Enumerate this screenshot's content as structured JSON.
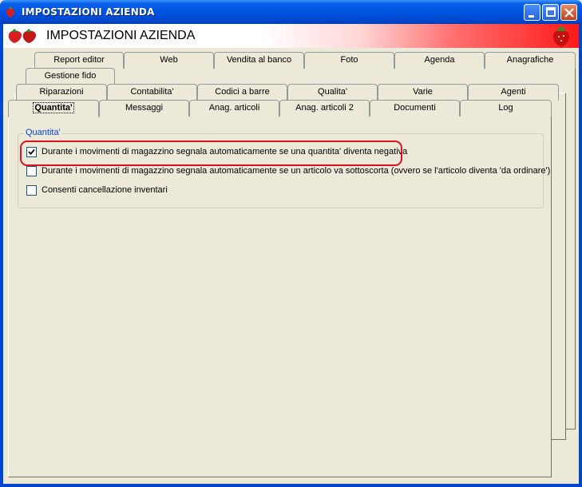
{
  "window": {
    "title": "IMPOSTAZIONI AZIENDA",
    "accent": "#0054e3"
  },
  "banner": {
    "title": "IMPOSTAZIONI AZIENDA",
    "gradient_end": "#ff1a1a"
  },
  "tabs": {
    "row1": [
      "Report editor",
      "Web",
      "Vendita al banco",
      "Foto",
      "Agenda",
      "Anagrafiche"
    ],
    "row1b": [
      "Gestione fido"
    ],
    "row2": [
      "Riparazioni",
      "Contabilita'",
      "Codici a barre",
      "Qualita'",
      "Varie",
      "Agenti"
    ],
    "row3": [
      "Quantita'",
      "Messaggi",
      "Anag. articoli",
      "Anag. articoli 2",
      "Documenti",
      "Log"
    ],
    "active": "Quantita'"
  },
  "group": {
    "label": "Quantita'",
    "options": [
      {
        "label": "Durante i movimenti di magazzino segnala automaticamente se una quantita' diventa negativa",
        "checked": true
      },
      {
        "label": "Durante i movimenti di magazzino segnala automaticamente se un articolo va sottoscorta (ovvero se l'articolo diventa 'da ordinare')",
        "checked": false
      },
      {
        "label": "Consenti cancellazione inventari",
        "checked": false
      }
    ]
  }
}
